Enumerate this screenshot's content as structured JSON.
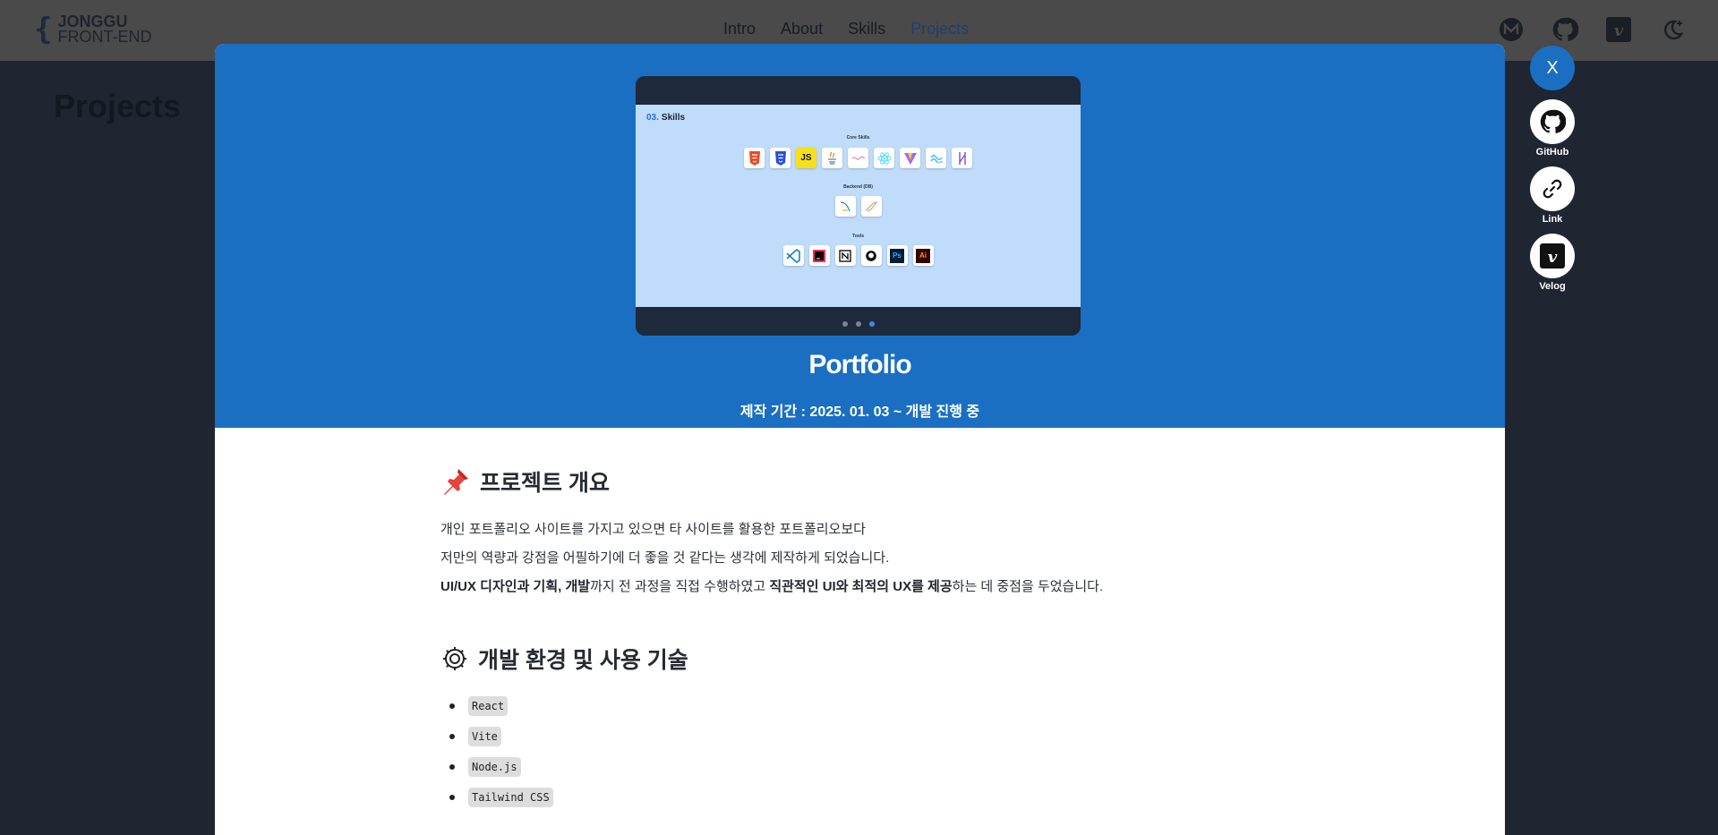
{
  "logo": {
    "name": "JONGGU",
    "sub": "FRONT-END",
    "brace": "{"
  },
  "nav": {
    "items": [
      {
        "label": "Intro",
        "active": false
      },
      {
        "label": "About",
        "active": false
      },
      {
        "label": "Skills",
        "active": false
      },
      {
        "label": "Projects",
        "active": true
      }
    ]
  },
  "top_icons": [
    "medium-icon",
    "github-icon",
    "velog-icon",
    "dark-mode-icon"
  ],
  "background": {
    "page_title": "Projects"
  },
  "modal": {
    "preview": {
      "slide_number": "03.",
      "slide_title": "Skills",
      "sections": [
        "Core Skills",
        "Backend (DB)",
        "Tools"
      ],
      "core_icons": [
        "html5-icon",
        "css3-icon",
        "javascript-icon",
        "java-icon",
        "styled-components-icon",
        "react-icon",
        "vite-icon",
        "tailwind-icon",
        "zustand-icon"
      ],
      "backend_icons": [
        "mysql-icon",
        "mariadb-icon"
      ],
      "tool_icons": [
        "vscode-icon",
        "intellij-icon",
        "notion-icon",
        "github-icon",
        "photoshop-icon",
        "illustrator-icon"
      ],
      "js_label": "JS",
      "ps_label": "Ps",
      "ai_label": "Ai",
      "dots": 3,
      "active_dot": 3
    },
    "title": "Portfolio",
    "period": "제작 기간 : 2025. 01. 03 ~ 개발 진행 중",
    "overview": {
      "heading": "프로젝트 개요",
      "line1": "개인 포트폴리오 사이트를 가지고 있으면 타 사이트를 활용한 포트폴리오보다",
      "line2": "저만의 역량과 강점을 어필하기에 더 좋을 것 같다는 생각에 제작하게 되었습니다.",
      "line3_b1": "UI/UX 디자인과 기획, 개발",
      "line3_t1": "까지 전 과정을 직접 수행하였고 ",
      "line3_b2": "직관적인 UI와 최적의 UX를 제공",
      "line3_t2": "하는 데 중점을 두었습니다."
    },
    "tech": {
      "heading": "개발 환경 및 사용 기술",
      "items": [
        "React",
        "Vite",
        "Node.js",
        "Tailwind CSS"
      ]
    }
  },
  "side": {
    "close_label": "X",
    "links": [
      {
        "label": "GitHub",
        "icon": "github-icon"
      },
      {
        "label": "Link",
        "icon": "link-icon"
      },
      {
        "label": "Velog",
        "icon": "velog-icon"
      }
    ]
  },
  "colors": {
    "accent": "#1a6fc2",
    "overlay_bg": "#1f2632"
  }
}
